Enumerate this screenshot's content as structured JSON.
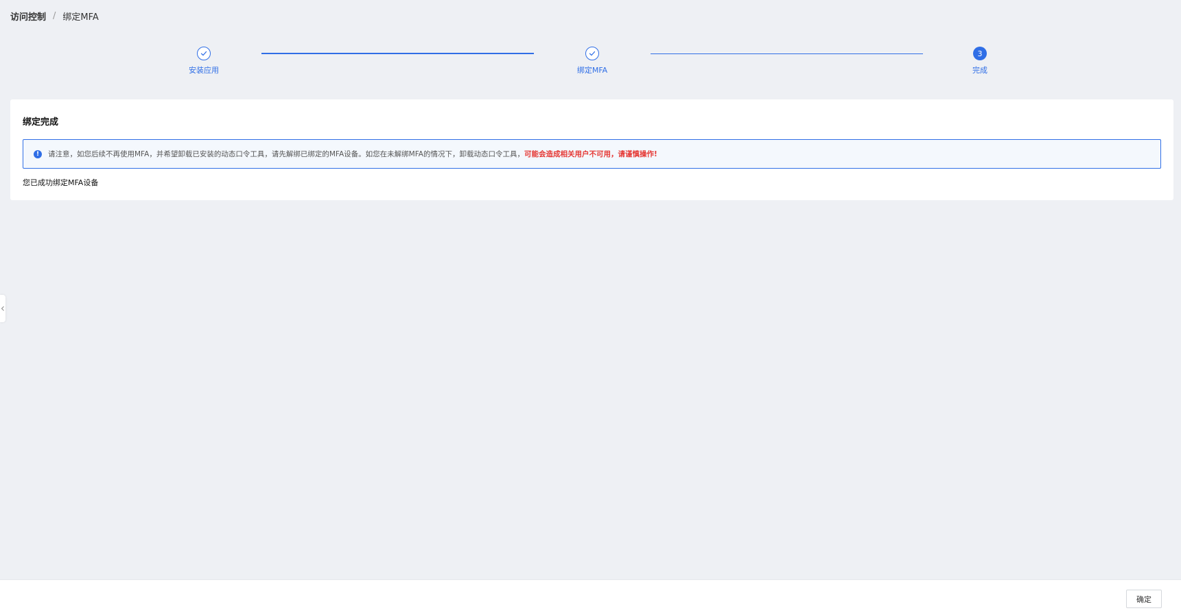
{
  "breadcrumb": {
    "root": "访问控制",
    "separator": "/",
    "current": "绑定MFA"
  },
  "steps": [
    {
      "label": "安装应用",
      "status": "done"
    },
    {
      "label": "绑定MFA",
      "status": "done"
    },
    {
      "label": "完成",
      "status": "active",
      "number": "3"
    }
  ],
  "card": {
    "title": "绑定完成",
    "notice": {
      "icon": "info-icon",
      "text": "请注意，如您后续不再使用MFA，并希望卸载已安装的动态口令工具，请先解绑已绑定的MFA设备。如您在未解绑MFA的情况下，卸载动态口令工具，",
      "warning": "可能会造成相关用户不可用，请谨慎操作!"
    },
    "success_text": "您已成功绑定MFA设备"
  },
  "footer": {
    "confirm_label": "确定"
  },
  "colors": {
    "accent": "#2f6ee6",
    "warning": "#e53935",
    "background": "#eef0f4"
  }
}
